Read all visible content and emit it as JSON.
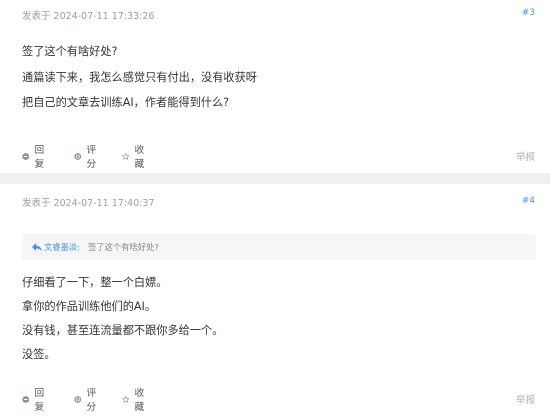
{
  "posts": [
    {
      "meta": "发表于 2024-07-11 17:33:26",
      "floor": "#3",
      "lines": [
        "签了这个有啥好处?",
        "通篇读下来，我怎么感觉只有付出，没有收获呀",
        "把自己的文章去训练AI，作者能得到什么?"
      ],
      "actions": {
        "reply": "回复",
        "rate": "评分",
        "favorite": "收藏"
      },
      "report": "举报"
    },
    {
      "meta": "发表于 2024-07-11 17:40:37",
      "floor": "#4",
      "quote": {
        "author": "文睿墨淡:",
        "text": "签了这个有啥好处?"
      },
      "lines": [
        "仔细看了一下，整一个白嫖。",
        "拿你的作品训练他们的AI。",
        "没有钱，甚至连流量都不跟你多给一个。",
        "没签。"
      ],
      "actions": {
        "reply": "回复",
        "rate": "评分",
        "favorite": "收藏"
      },
      "report": "举报"
    }
  ],
  "colors": {
    "link": "#4a90e2",
    "muted": "#9aa0a6",
    "icon": "#8b939c",
    "divider": "#eef0f3"
  },
  "icons": {
    "reply": "minus-circle-icon",
    "rate": "rate-circle-icon",
    "favorite": "star-icon",
    "quote": "reply-arrow-icon"
  }
}
